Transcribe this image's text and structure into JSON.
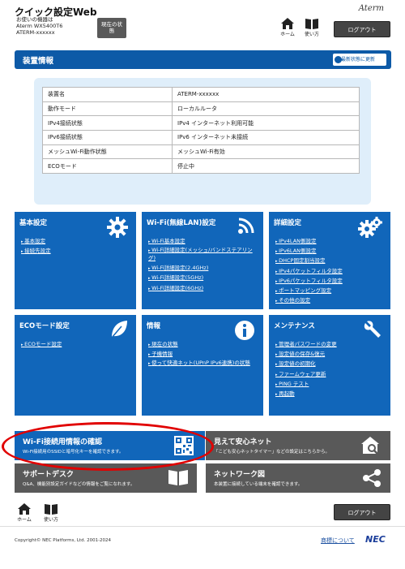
{
  "header": {
    "title": "クイック設定Web",
    "device_label": "お使いの機器は",
    "model": "Aterm WX5400T6",
    "hostname": "ATERM-xxxxxx",
    "status_button": "現在の状態",
    "brand": "Aterm",
    "home_label": "ホーム",
    "help_label": "使い方",
    "logout_label": "ログアウト"
  },
  "device_panel": {
    "title": "装置情報",
    "refresh_label": "最新状態に更新",
    "rows": [
      {
        "key": "装置名",
        "value": "ATERM-xxxxxx"
      },
      {
        "key": "動作モード",
        "value": "ローカルルータ"
      },
      {
        "key": "IPv4接続状態",
        "value": "IPv4 インターネット利用可能"
      },
      {
        "key": "IPv6接続状態",
        "value": "IPv6 インターネット未接続"
      },
      {
        "key": "メッシュWi-Fi動作状態",
        "value": "メッシュWi-Fi有効"
      },
      {
        "key": "ECOモード",
        "value": "停止中"
      }
    ]
  },
  "tiles": {
    "basic": {
      "title": "基本設定",
      "icon": "gear-icon",
      "links": [
        "基本設定",
        "接続先設定"
      ]
    },
    "wifi": {
      "title": "Wi-Fi(無線LAN)設定",
      "icon": "wifi-icon",
      "links": [
        "Wi-Fi基本設定",
        "Wi-Fi詳細設定(メッシュ/バンドステアリング)",
        "Wi-Fi詳細設定(2.4GHz)",
        "Wi-Fi詳細設定(5GHz)",
        "Wi-Fi詳細設定(6GHz)"
      ]
    },
    "advanced": {
      "title": "詳細設定",
      "icon": "gears-icon",
      "links": [
        "IPv4LAN側設定",
        "IPv6LAN側設定",
        "DHCP固定割当設定",
        "IPv4パケットフィルタ設定",
        "IPv6パケットフィルタ設定",
        "ポートマッピング設定",
        "その他の設定"
      ]
    },
    "eco": {
      "title": "ECOモード設定",
      "icon": "leaf-icon",
      "links": [
        "ECOモード設定"
      ]
    },
    "info": {
      "title": "情報",
      "icon": "info-icon",
      "links": [
        "現在の状態",
        "子機情報",
        "使って快適ネット(UPnP IPv6連携)の状態"
      ]
    },
    "maintenance": {
      "title": "メンテナンス",
      "icon": "wrench-icon",
      "links": [
        "管理者パスワードの変更",
        "設定値の保存&復元",
        "設定値の初期化",
        "ファームウェア更新",
        "PING テスト",
        "再起動"
      ]
    }
  },
  "banners": {
    "wifi_info": {
      "title": "Wi-Fi接続用情報の確認",
      "desc": "Wi-Fi接続用のSSIDと暗号化キーを確認できます。"
    },
    "safe_net": {
      "title": "見えて安心ネット",
      "desc": "「こども安心ネットタイマー」などの設定はこちらから。"
    },
    "support": {
      "title": "サポートデスク",
      "desc": "Q&A、機能別設定ガイドなどの情報をご覧になれます。"
    },
    "network_map": {
      "title": "ネットワーク図",
      "desc": "本装置に接続している端末を確認できます。"
    }
  },
  "footer": {
    "home_label": "ホーム",
    "help_label": "使い方",
    "logout_label": "ログアウト",
    "copyright": "Copyright© NEC Platforms, Ltd. 2001-2024",
    "trademark": "商標について",
    "nec": "NEC"
  },
  "colors": {
    "primary": "#1166ba",
    "header_bar": "#0d5aa7",
    "banner": "#595959",
    "highlight": "#e10000"
  }
}
